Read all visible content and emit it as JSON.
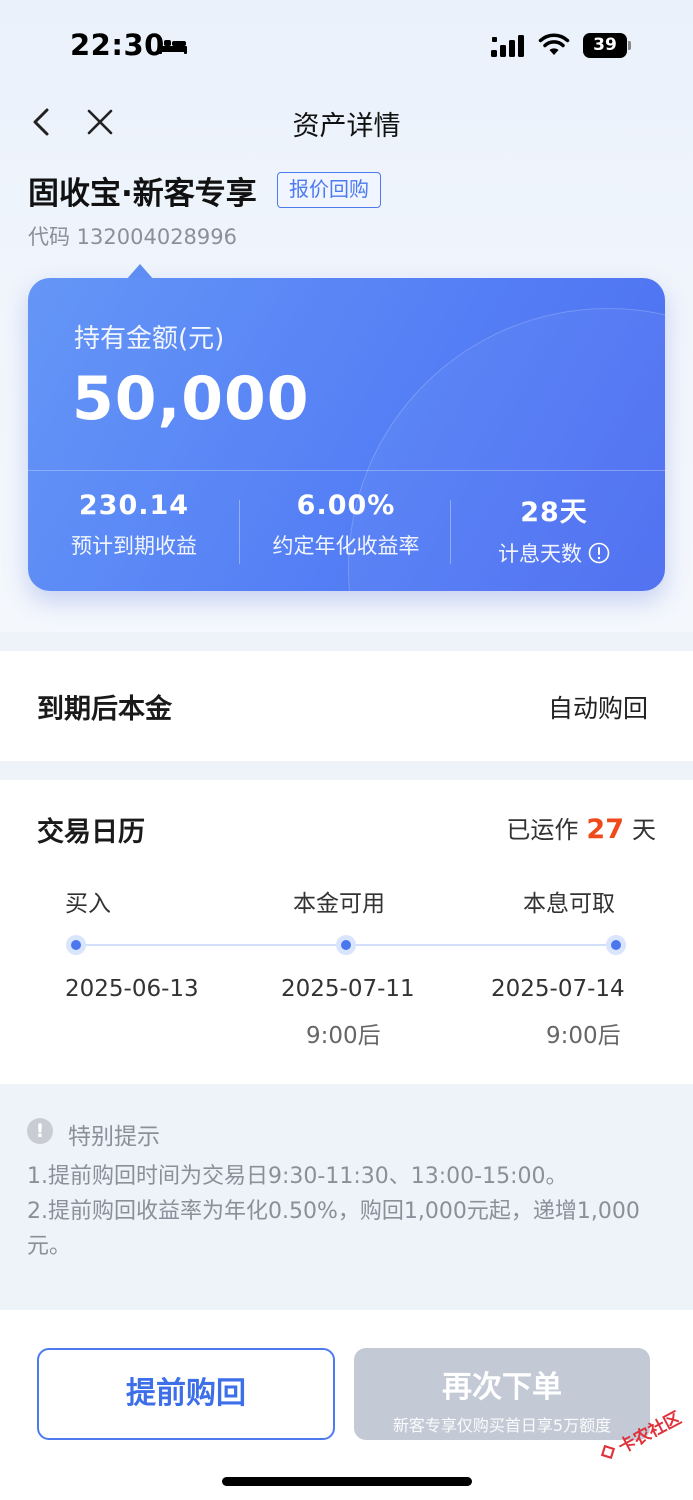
{
  "status_bar": {
    "time": "22:30",
    "battery": "39"
  },
  "nav": {
    "title": "资产详情"
  },
  "product": {
    "name": "固收宝·新客专享",
    "tag": "报价回购",
    "code": "代码 132004028996"
  },
  "card": {
    "holding_label": "持有金额(元)",
    "holding_value": "50,000",
    "stats": [
      {
        "value": "230.14",
        "label": "预计到期收益"
      },
      {
        "value": "6.00%",
        "label": "约定年化收益率"
      },
      {
        "value": "28天",
        "label": "计息天数"
      }
    ]
  },
  "maturity": {
    "label": "到期后本金",
    "value": "自动购回"
  },
  "calendar": {
    "title": "交易日历",
    "running_prefix": "已运作",
    "running_days": "27",
    "running_suffix": "天",
    "steps": [
      {
        "name": "买入",
        "date": "2025-06-13",
        "time": ""
      },
      {
        "name": "本金可用",
        "date": "2025-07-11",
        "time": "9:00后"
      },
      {
        "name": "本息可取",
        "date": "2025-07-14",
        "time": "9:00后"
      }
    ]
  },
  "notice": {
    "title": "特别提示",
    "lines": [
      "1.提前购回时间为交易日9:30-11:30、13:00-15:00。",
      "2.提前购回收益率为年化0.50%，购回1,000元起，递增1,000元。"
    ]
  },
  "actions": {
    "redeem_label": "提前购回",
    "order_label": "再次下单",
    "order_sublabel": "新客专享仅购买首日享5万额度"
  },
  "watermark": "卡农社区",
  "colors": {
    "accent": "#4d7bef",
    "highlight": "#f04a1a",
    "disabled": "#c3cad6"
  }
}
